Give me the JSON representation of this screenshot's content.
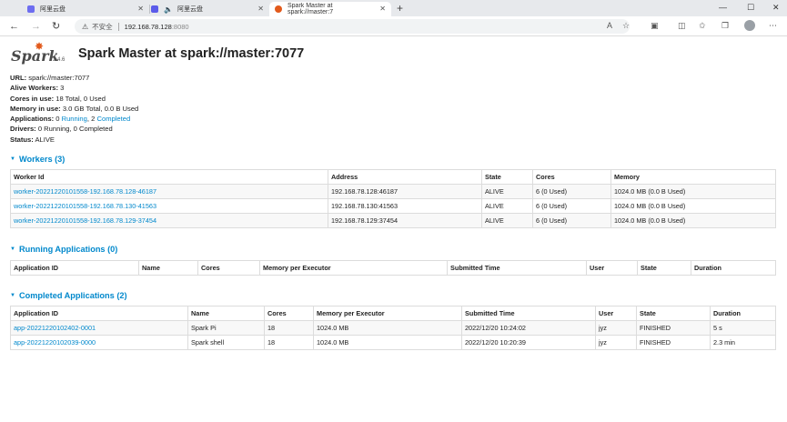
{
  "browser": {
    "tabs": [
      {
        "label": "阿里云盘",
        "icon": "aliyun-drive-icon"
      },
      {
        "label": "阿里云盘",
        "icon": "aliyun-drive-icon"
      },
      {
        "label": "Spark Master at spark://master:7",
        "icon": "spark-tab-icon"
      }
    ],
    "new_tab": "+",
    "window_controls": {
      "minimize": "—",
      "maximize": "☐",
      "close": "✕"
    },
    "nav": {
      "back": "←",
      "forward": "→",
      "refresh": "↻",
      "home": "⌂"
    },
    "address": {
      "warning": "⚠",
      "insecure_label": "不安全",
      "host": "192.168.78.128",
      "port": ":8080"
    }
  },
  "page": {
    "logo_text": "Spark",
    "version": "2.4.6",
    "title": "Spark Master at spark://master:7077"
  },
  "summary": {
    "url_label": "URL:",
    "url_value": "spark://master:7077",
    "workers_label": "Alive Workers:",
    "workers_value": "3",
    "cores_label": "Cores in use:",
    "cores_value": "18 Total, 0 Used",
    "memory_label": "Memory in use:",
    "memory_value": "3.0 GB Total, 0.0 B Used",
    "apps_label": "Applications:",
    "apps_running_count": "0",
    "apps_running_link": "Running",
    "apps_sep": ", ",
    "apps_completed_count": "2",
    "apps_completed_link": "Completed",
    "drivers_label": "Drivers:",
    "drivers_value": "0 Running, 0 Completed",
    "status_label": "Status:",
    "status_value": "ALIVE"
  },
  "workers": {
    "heading": "Workers (3)",
    "columns": [
      "Worker Id",
      "Address",
      "State",
      "Cores",
      "Memory"
    ],
    "rows": [
      [
        "worker-20221220101558-192.168.78.128-46187",
        "192.168.78.128:46187",
        "ALIVE",
        "6 (0 Used)",
        "1024.0 MB (0.0 B Used)"
      ],
      [
        "worker-20221220101558-192.168.78.130-41563",
        "192.168.78.130:41563",
        "ALIVE",
        "6 (0 Used)",
        "1024.0 MB (0.0 B Used)"
      ],
      [
        "worker-20221220101558-192.168.78.129-37454",
        "192.168.78.129:37454",
        "ALIVE",
        "6 (0 Used)",
        "1024.0 MB (0.0 B Used)"
      ]
    ]
  },
  "running": {
    "heading": "Running Applications (0)",
    "columns": [
      "Application ID",
      "Name",
      "Cores",
      "Memory per Executor",
      "Submitted Time",
      "User",
      "State",
      "Duration"
    ]
  },
  "completed": {
    "heading": "Completed Applications (2)",
    "columns": [
      "Application ID",
      "Name",
      "Cores",
      "Memory per Executor",
      "Submitted Time",
      "User",
      "State",
      "Duration"
    ],
    "rows": [
      [
        "app-20221220102402-0001",
        "Spark Pi",
        "18",
        "1024.0 MB",
        "2022/12/20 10:24:02",
        "jyz",
        "FINISHED",
        "5 s"
      ],
      [
        "app-20221220102039-0000",
        "Spark shell",
        "18",
        "1024.0 MB",
        "2022/12/20 10:20:39",
        "jyz",
        "FINISHED",
        "2.3 min"
      ]
    ]
  },
  "colors": {
    "link": "#0088cc",
    "spark_orange": "#e25a1c"
  }
}
